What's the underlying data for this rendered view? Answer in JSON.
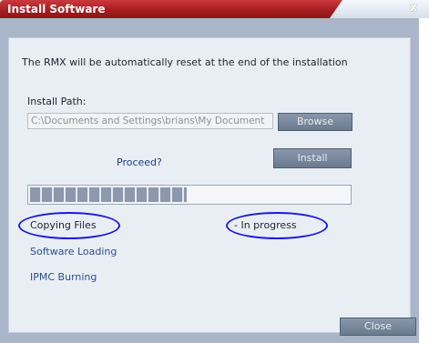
{
  "window": {
    "title": "Install Software",
    "close_glyph": "x"
  },
  "message": "The RMX will be automatically reset at the end of the installation",
  "install_path": {
    "label": "Install Path:",
    "value": "C:\\Documents and Settings\\brians\\My Document"
  },
  "buttons": {
    "browse": "Browse",
    "install": "Install",
    "close": "Close"
  },
  "proceed_text": "Proceed?",
  "progress": {
    "fraction": 0.49
  },
  "steps": [
    {
      "label": "Copying Files",
      "status": "- In progress"
    },
    {
      "label": "Software Loading"
    },
    {
      "label": "IPMC Burning"
    }
  ],
  "colors": {
    "title_bar": "#a81e22",
    "annotation": "#1a1ae0",
    "button": "#7a889c"
  }
}
